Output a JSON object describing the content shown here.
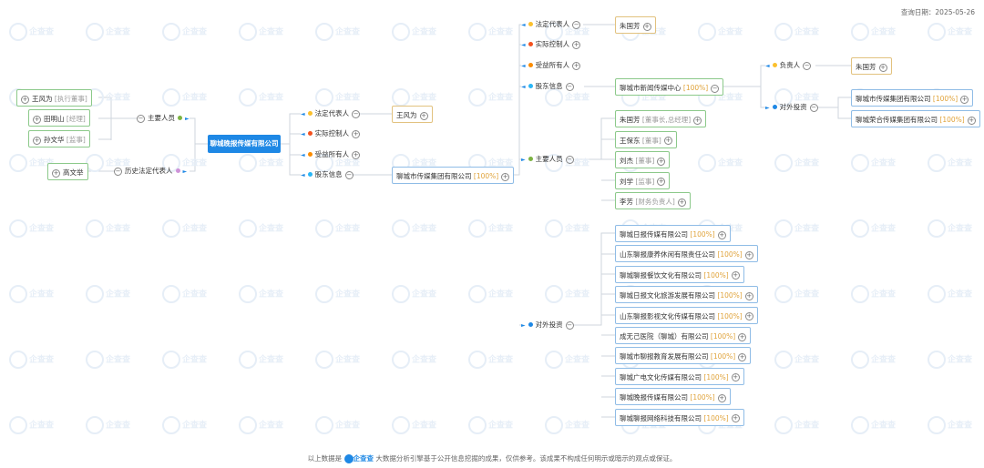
{
  "query_date": "查询日期：2025-05-26",
  "watermark": "企查查",
  "center": "聊城晚报传媒有限公司",
  "left": {
    "main_personnel_label": "主要人员",
    "history_legal_label": "历史法定代表人",
    "people": [
      {
        "name": "王风为",
        "role": "[执行董事]"
      },
      {
        "name": "田明山",
        "role": "[经理]"
      },
      {
        "name": "孙文华",
        "role": "[监事]"
      }
    ],
    "history_person": "高文举"
  },
  "mid": {
    "legal_label": "法定代表人",
    "controller_label": "实际控制人",
    "beneficiary_label": "受益所有人",
    "shareholder_label": "股东信息",
    "legal_person": "王风为",
    "shareholder": {
      "name": "聊城市传媒集团有限公司",
      "pct": "[100%]"
    }
  },
  "right": {
    "legal_label": "法定代表人",
    "controller_label": "实际控制人",
    "beneficiary_label": "受益所有人",
    "shareholder_label": "股东信息",
    "personnel_label": "主要人员",
    "invest_label": "对外投资",
    "legal_person": "朱国芳",
    "shareholder": {
      "name": "聊城市新闻传媒中心",
      "pct": "[100%]"
    },
    "personnel": [
      {
        "name": "朱国芳",
        "role": "[董事长,总经理]"
      },
      {
        "name": "王保东",
        "role": "[董事]"
      },
      {
        "name": "刘杰",
        "role": "[董事]"
      },
      {
        "name": "刘学",
        "role": "[监事]"
      },
      {
        "name": "李芳",
        "role": "[财务负责人]"
      }
    ],
    "investments": [
      {
        "name": "聊城日报传媒有限公司",
        "pct": "[100%]"
      },
      {
        "name": "山东聊报康养休闲有限责任公司",
        "pct": "[100%]"
      },
      {
        "name": "聊城聊报餐饮文化有限公司",
        "pct": "[100%]"
      },
      {
        "name": "聊城日报文化旅游发展有限公司",
        "pct": "[100%]"
      },
      {
        "name": "山东聊报影视文化传媒有限公司",
        "pct": "[100%]"
      },
      {
        "name": "成无己医院（聊城）有限公司",
        "pct": "[100%]"
      },
      {
        "name": "聊城市聊报教育发展有限公司",
        "pct": "[100%]"
      },
      {
        "name": "聊城广电文化传媒有限公司",
        "pct": "[100%]"
      },
      {
        "name": "聊城晚报传媒有限公司",
        "pct": "[100%]"
      },
      {
        "name": "聊城聊报网络科技有限公司",
        "pct": "[100%]"
      }
    ]
  },
  "far": {
    "responsible_label": "负责人",
    "invest_label": "对外投资",
    "responsible_person": "朱国芳",
    "investments": [
      {
        "name": "聊城市传媒集团有限公司",
        "pct": "[100%]"
      },
      {
        "name": "聊城荣合传媒集团有限公司",
        "pct": "[100%]"
      }
    ]
  },
  "footer": {
    "prefix": "以上数据是",
    "brand": "企查查",
    "suffix": "大数据分析引擎基于公开信息挖掘的成果，仅供参考。该成果不构成任何明示或暗示的观点或保证。"
  },
  "colors": {
    "accent": "#1e88e5",
    "green": "#7cb342",
    "red": "#f4511e",
    "orange": "#fb8c00",
    "yellow": "#fbc02d",
    "cyan": "#29b6f6",
    "violet": "#ce93d8"
  }
}
